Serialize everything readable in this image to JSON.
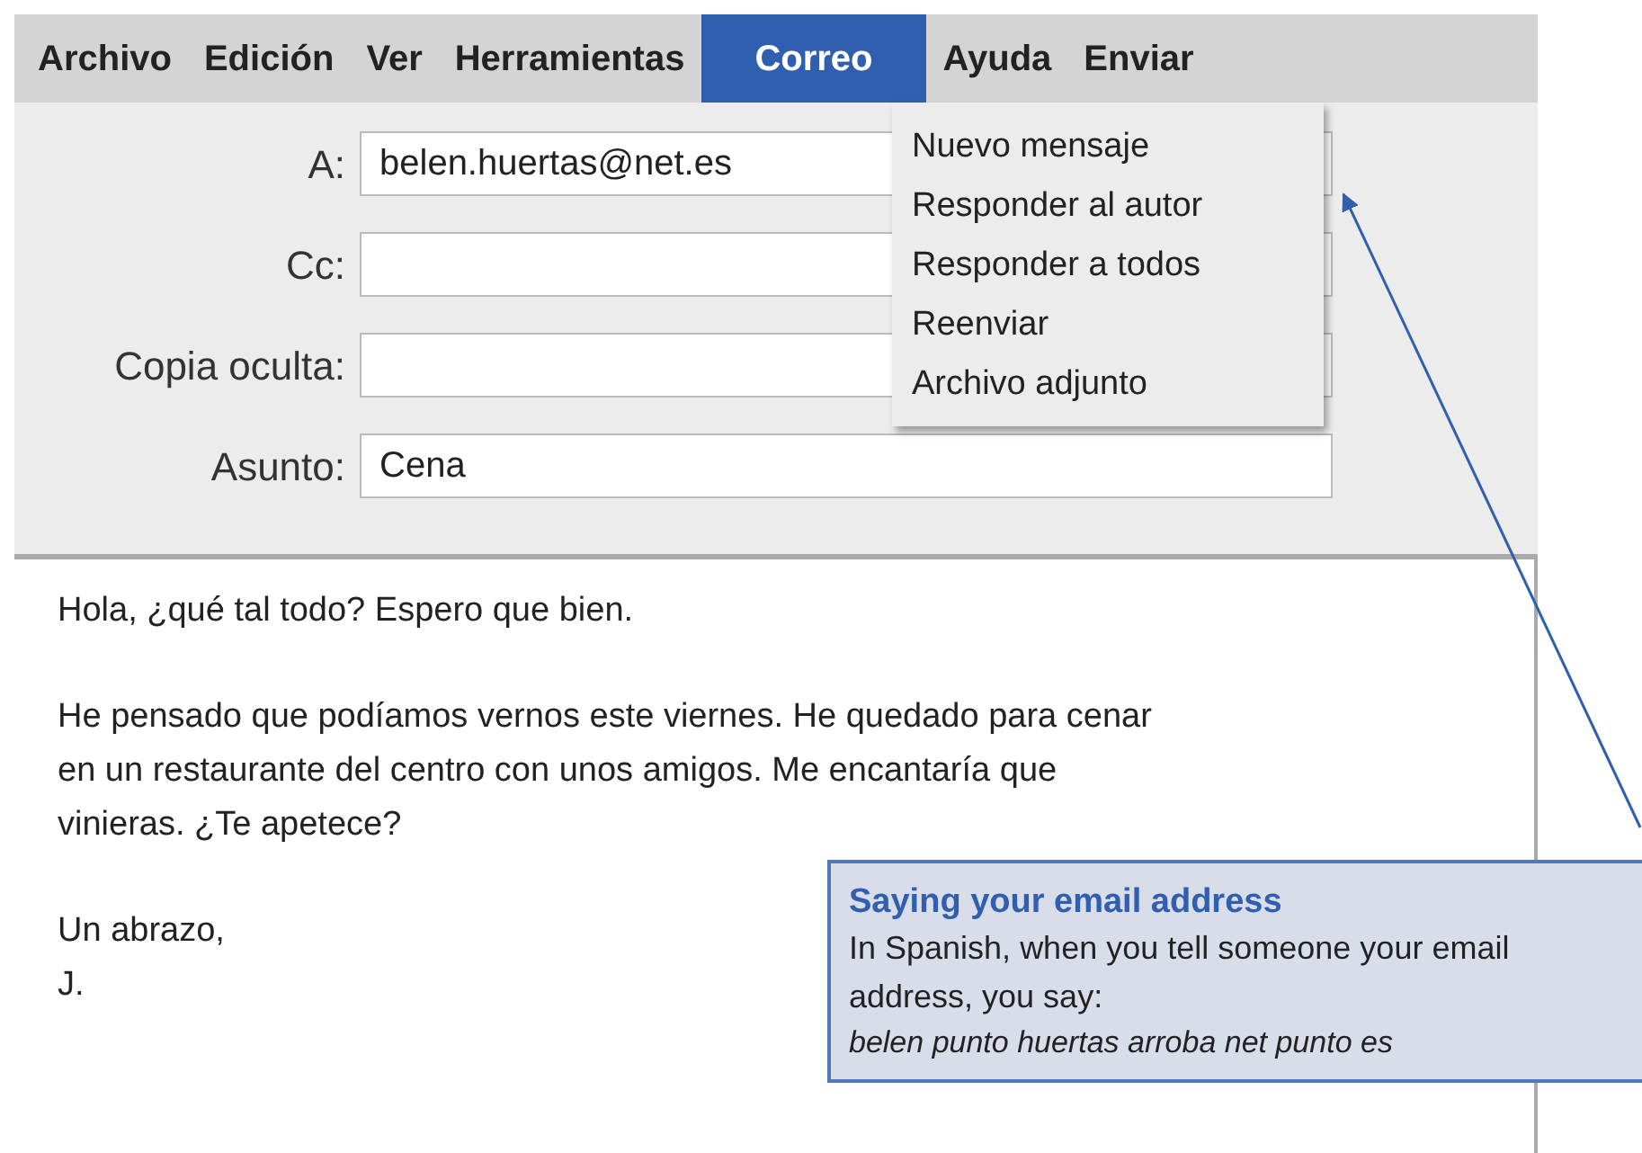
{
  "menu_bar": [
    {
      "label": "Archivo",
      "selected": false
    },
    {
      "label": "Edición",
      "selected": false
    },
    {
      "label": "Ver",
      "selected": false
    },
    {
      "label": "Herramientas",
      "selected": false
    },
    {
      "label": "Correo",
      "selected": true
    },
    {
      "label": "Ayuda",
      "selected": false
    },
    {
      "label": "Enviar",
      "selected": false
    }
  ],
  "dropdown": [
    "Nuevo mensaje",
    "Responder al autor",
    "Responder a todos",
    "Reenviar",
    "Archivo adjunto"
  ],
  "fields": [
    {
      "label": "A:",
      "value": "belen.huertas@net.es"
    },
    {
      "label": "Cc:"
    },
    {
      "label": "Copia oculta:"
    },
    {
      "label": "Asunto:",
      "value": "Cena"
    }
  ],
  "message": [
    {
      "lines": [
        "Hola, ¿qué tal todo? Espero que bien."
      ]
    },
    {
      "lines": [
        "He pensado que podíamos vernos este viernes. He quedado para cenar",
        "en un restaurante del centro con unos amigos. Me encantaría que",
        "vinieras. ¿Te apetece?"
      ]
    },
    {
      "lines": [
        "Un abrazo,",
        "J."
      ]
    }
  ],
  "callout": {
    "title": "Saying your email address",
    "text": "In Spanish, when you tell someone your email address, you say:",
    "example": "belen punto huertas arroba net punto es"
  }
}
